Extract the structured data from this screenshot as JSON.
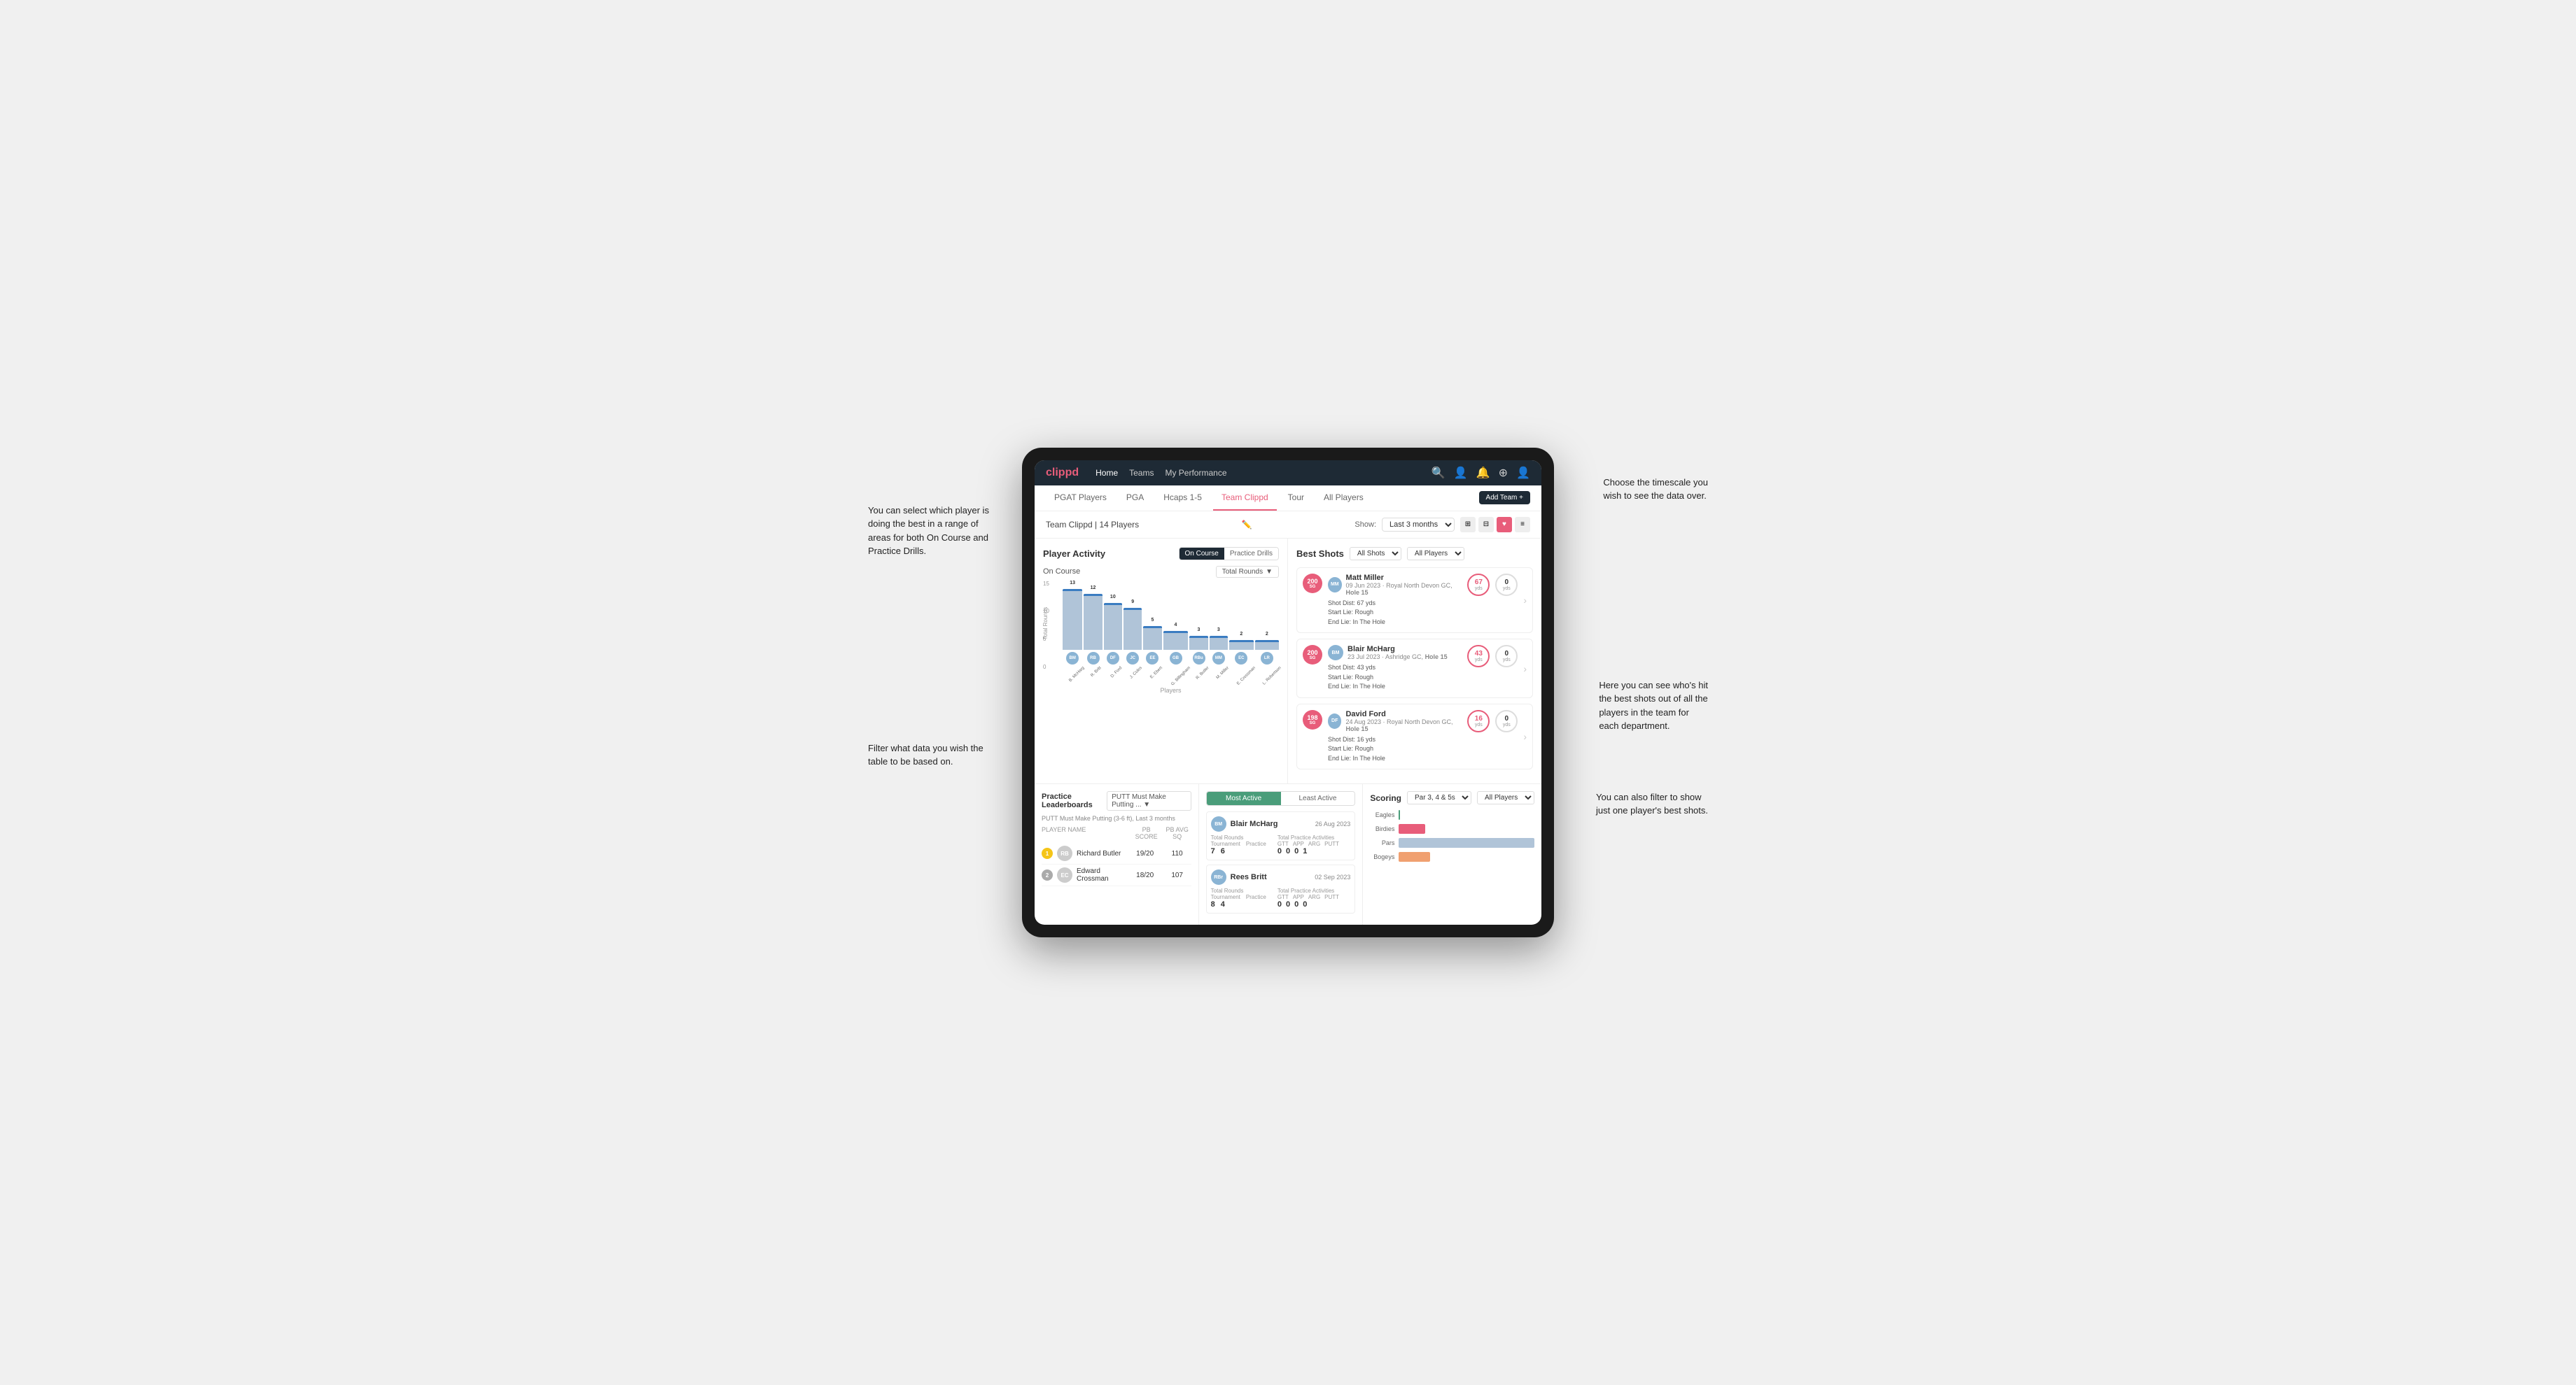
{
  "annotations": {
    "top_left": "You can select which player is\ndoing the best in a range of\nareas for both On Course and\nPractice Drills.",
    "bottom_left": "Filter what data you wish the\ntable to be based on.",
    "top_right": "Choose the timescale you\nwish to see the data over.",
    "middle_right": "Here you can see who's hit\nthe best shots out of all the\nplayers in the team for\neach department.",
    "bottom_right": "You can also filter to show\njust one player's best shots."
  },
  "nav": {
    "logo": "clippd",
    "links": [
      "Home",
      "Teams",
      "My Performance"
    ],
    "icons": [
      "🔍",
      "👤",
      "🔔",
      "⊕",
      "👤"
    ]
  },
  "tabs": {
    "items": [
      "PGAT Players",
      "PGA",
      "Hcaps 1-5",
      "Team Clippd",
      "Tour",
      "All Players"
    ],
    "active": "Team Clippd",
    "add_button": "Add Team +"
  },
  "team_header": {
    "title": "Team Clippd | 14 Players",
    "show_label": "Show:",
    "show_value": "Last 3 months",
    "view_options": [
      "grid",
      "grid2",
      "heart",
      "list"
    ]
  },
  "player_activity": {
    "title": "Player Activity",
    "toggle_options": [
      "On Course",
      "Practice Drills"
    ],
    "active_toggle": "On Course",
    "chart_sublabel": "On Course",
    "chart_filter": "Total Rounds",
    "y_axis": [
      "15",
      "10",
      "5",
      "0"
    ],
    "bars": [
      {
        "name": "B. McHarg",
        "value": 13,
        "color": "#b0c4d8",
        "initials": "BM"
      },
      {
        "name": "R. Britt",
        "value": 12,
        "color": "#b0c4d8",
        "initials": "RB"
      },
      {
        "name": "D. Ford",
        "value": 10,
        "color": "#b0c4d8",
        "initials": "DF"
      },
      {
        "name": "J. Coles",
        "value": 9,
        "color": "#b0c4d8",
        "initials": "JC"
      },
      {
        "name": "E. Ebert",
        "value": 5,
        "color": "#b0c4d8",
        "initials": "EE"
      },
      {
        "name": "G. Billingham",
        "value": 4,
        "color": "#b0c4d8",
        "initials": "GB"
      },
      {
        "name": "R. Butler",
        "value": 3,
        "color": "#b0c4d8",
        "initials": "RBu"
      },
      {
        "name": "M. Miller",
        "value": 3,
        "color": "#b0c4d8",
        "initials": "MM"
      },
      {
        "name": "E. Crossman",
        "value": 2,
        "color": "#b0c4d8",
        "initials": "EC"
      },
      {
        "name": "L. Robertson",
        "value": 2,
        "color": "#b0c4d8",
        "initials": "LR"
      }
    ],
    "x_label": "Players",
    "y_label": "Total Rounds"
  },
  "best_shots": {
    "title": "Best Shots",
    "filter1": "All Shots",
    "filter2": "All Players",
    "players": [
      {
        "name": "Matt Miller",
        "date": "09 Jun 2023 · Royal North Devon GC,",
        "hole": "Hole 15",
        "badge": "200",
        "badge_sub": "SG",
        "badge_color": "pink",
        "shot_dist": "Shot Dist: 67 yds",
        "start_lie": "Start Lie: Rough",
        "end_lie": "End Lie: In The Hole",
        "stat1_val": "67",
        "stat1_unit": "yds",
        "stat2_val": "0",
        "stat2_unit": "yds"
      },
      {
        "name": "Blair McHarg",
        "date": "23 Jul 2023 · Ashridge GC,",
        "hole": "Hole 15",
        "badge": "200",
        "badge_sub": "SG",
        "badge_color": "pink",
        "shot_dist": "Shot Dist: 43 yds",
        "start_lie": "Start Lie: Rough",
        "end_lie": "End Lie: In The Hole",
        "stat1_val": "43",
        "stat1_unit": "yds",
        "stat2_val": "0",
        "stat2_unit": "yds"
      },
      {
        "name": "David Ford",
        "date": "24 Aug 2023 · Royal North Devon GC,",
        "hole": "Hole 15",
        "badge": "198",
        "badge_sub": "SG",
        "badge_color": "pink",
        "shot_dist": "Shot Dist: 16 yds",
        "start_lie": "Start Lie: Rough",
        "end_lie": "End Lie: In The Hole",
        "stat1_val": "16",
        "stat1_unit": "yds",
        "stat2_val": "0",
        "stat2_unit": "yds"
      }
    ]
  },
  "practice_leaderboard": {
    "title": "Practice Leaderboards",
    "filter": "PUTT Must Make Putting ...",
    "subtitle": "PUTT Must Make Putting (3-6 ft), Last 3 months",
    "columns": [
      "PLAYER NAME",
      "PB SCORE",
      "PB AVG SQ"
    ],
    "players": [
      {
        "rank": "1",
        "name": "Richard Butler",
        "score": "19/20",
        "avg": "110",
        "initials": "RB",
        "badge_color": "gold"
      },
      {
        "rank": "2",
        "name": "Edward Crossman",
        "score": "18/20",
        "avg": "107",
        "initials": "EC",
        "badge_color": "silver"
      }
    ]
  },
  "most_active": {
    "toggle_options": [
      "Most Active",
      "Least Active"
    ],
    "active": "Most Active",
    "players": [
      {
        "name": "Blair McHarg",
        "date": "26 Aug 2023",
        "initials": "BM",
        "rounds_label": "Total Rounds",
        "tournament": "7",
        "practice": "6",
        "activities_label": "Total Practice Activities",
        "gtt": "0",
        "app": "0",
        "arg": "0",
        "putt": "1"
      },
      {
        "name": "Rees Britt",
        "date": "02 Sep 2023",
        "initials": "RBr",
        "rounds_label": "Total Rounds",
        "tournament": "8",
        "practice": "4",
        "activities_label": "Total Practice Activities",
        "gtt": "0",
        "app": "0",
        "arg": "0",
        "putt": "0"
      }
    ]
  },
  "scoring": {
    "title": "Scoring",
    "filter1": "Par 3, 4 & 5s",
    "filter2": "All Players",
    "bars": [
      {
        "label": "Eagles",
        "value": 3,
        "max": 500,
        "color": "#4a9d7a"
      },
      {
        "label": "Birdies",
        "value": 96,
        "max": 500,
        "color": "#e85d7a"
      },
      {
        "label": "Pars",
        "value": 499,
        "max": 500,
        "color": "#b0c4d8"
      },
      {
        "label": "Bogeys",
        "value": 115,
        "max": 500,
        "color": "#f0a070"
      }
    ]
  }
}
